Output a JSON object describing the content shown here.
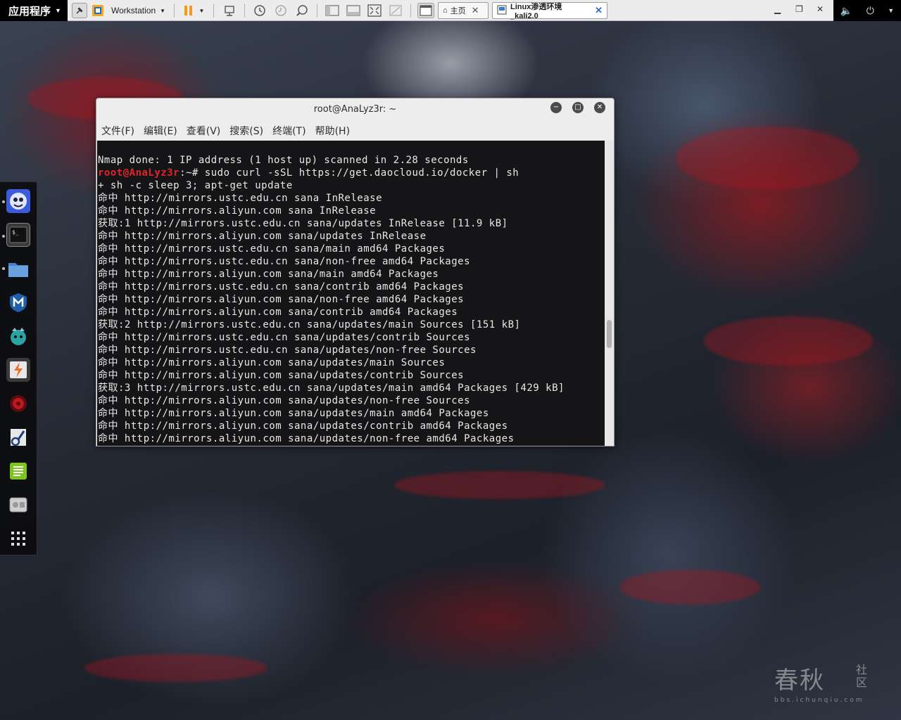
{
  "topbar": {
    "apps_menu_label": "应用程序",
    "workstation_label": "Workstation",
    "tabs": [
      {
        "label": "主页"
      },
      {
        "label": "Linux渗透环境_kali2.0"
      }
    ]
  },
  "terminal": {
    "title": "root@AnaLyz3r: ~",
    "menu": [
      "文件(F)",
      "编辑(E)",
      "查看(V)",
      "搜索(S)",
      "终端(T)",
      "帮助(H)"
    ],
    "lines": [
      {
        "text": "Nmap done: 1 IP address (1 host up) scanned in 2.28 seconds"
      },
      {
        "prompt_user": "root@AnaLyz3r",
        "text": ":~# sudo curl -sSL https://get.daocloud.io/docker | sh"
      },
      {
        "text": "+ sh -c sleep 3; apt-get update"
      },
      {
        "text": "命中 http://mirrors.ustc.edu.cn sana InRelease"
      },
      {
        "text": "命中 http://mirrors.aliyun.com sana InRelease"
      },
      {
        "text": "获取:1 http://mirrors.ustc.edu.cn sana/updates InRelease [11.9 kB]"
      },
      {
        "text": "命中 http://mirrors.aliyun.com sana/updates InRelease"
      },
      {
        "text": "命中 http://mirrors.ustc.edu.cn sana/main amd64 Packages"
      },
      {
        "text": "命中 http://mirrors.ustc.edu.cn sana/non-free amd64 Packages"
      },
      {
        "text": "命中 http://mirrors.aliyun.com sana/main amd64 Packages"
      },
      {
        "text": "命中 http://mirrors.ustc.edu.cn sana/contrib amd64 Packages"
      },
      {
        "text": "命中 http://mirrors.aliyun.com sana/non-free amd64 Packages"
      },
      {
        "text": "命中 http://mirrors.aliyun.com sana/contrib amd64 Packages"
      },
      {
        "text": "获取:2 http://mirrors.ustc.edu.cn sana/updates/main Sources [151 kB]"
      },
      {
        "text": "命中 http://mirrors.ustc.edu.cn sana/updates/contrib Sources"
      },
      {
        "text": "命中 http://mirrors.ustc.edu.cn sana/updates/non-free Sources"
      },
      {
        "text": "命中 http://mirrors.aliyun.com sana/updates/main Sources"
      },
      {
        "text": "命中 http://mirrors.aliyun.com sana/updates/contrib Sources"
      },
      {
        "text": "获取:3 http://mirrors.ustc.edu.cn sana/updates/main amd64 Packages [429 kB]"
      },
      {
        "text": "命中 http://mirrors.aliyun.com sana/updates/non-free Sources"
      },
      {
        "text": "命中 http://mirrors.aliyun.com sana/updates/main amd64 Packages"
      },
      {
        "text": "命中 http://mirrors.aliyun.com sana/updates/contrib amd64 Packages"
      },
      {
        "text": "命中 http://mirrors.aliyun.com sana/updates/non-free amd64 Packages"
      }
    ]
  },
  "watermark": {
    "main": "春秋",
    "side_line1": "社",
    "side_line2": "区",
    "url": "bbs.ichunqiu.com"
  },
  "colors": {
    "prompt_user": "#e0242a",
    "terminal_bg": "#040406",
    "apps_menu_bg": "#000000",
    "pause_orange": "#f39a1e"
  }
}
